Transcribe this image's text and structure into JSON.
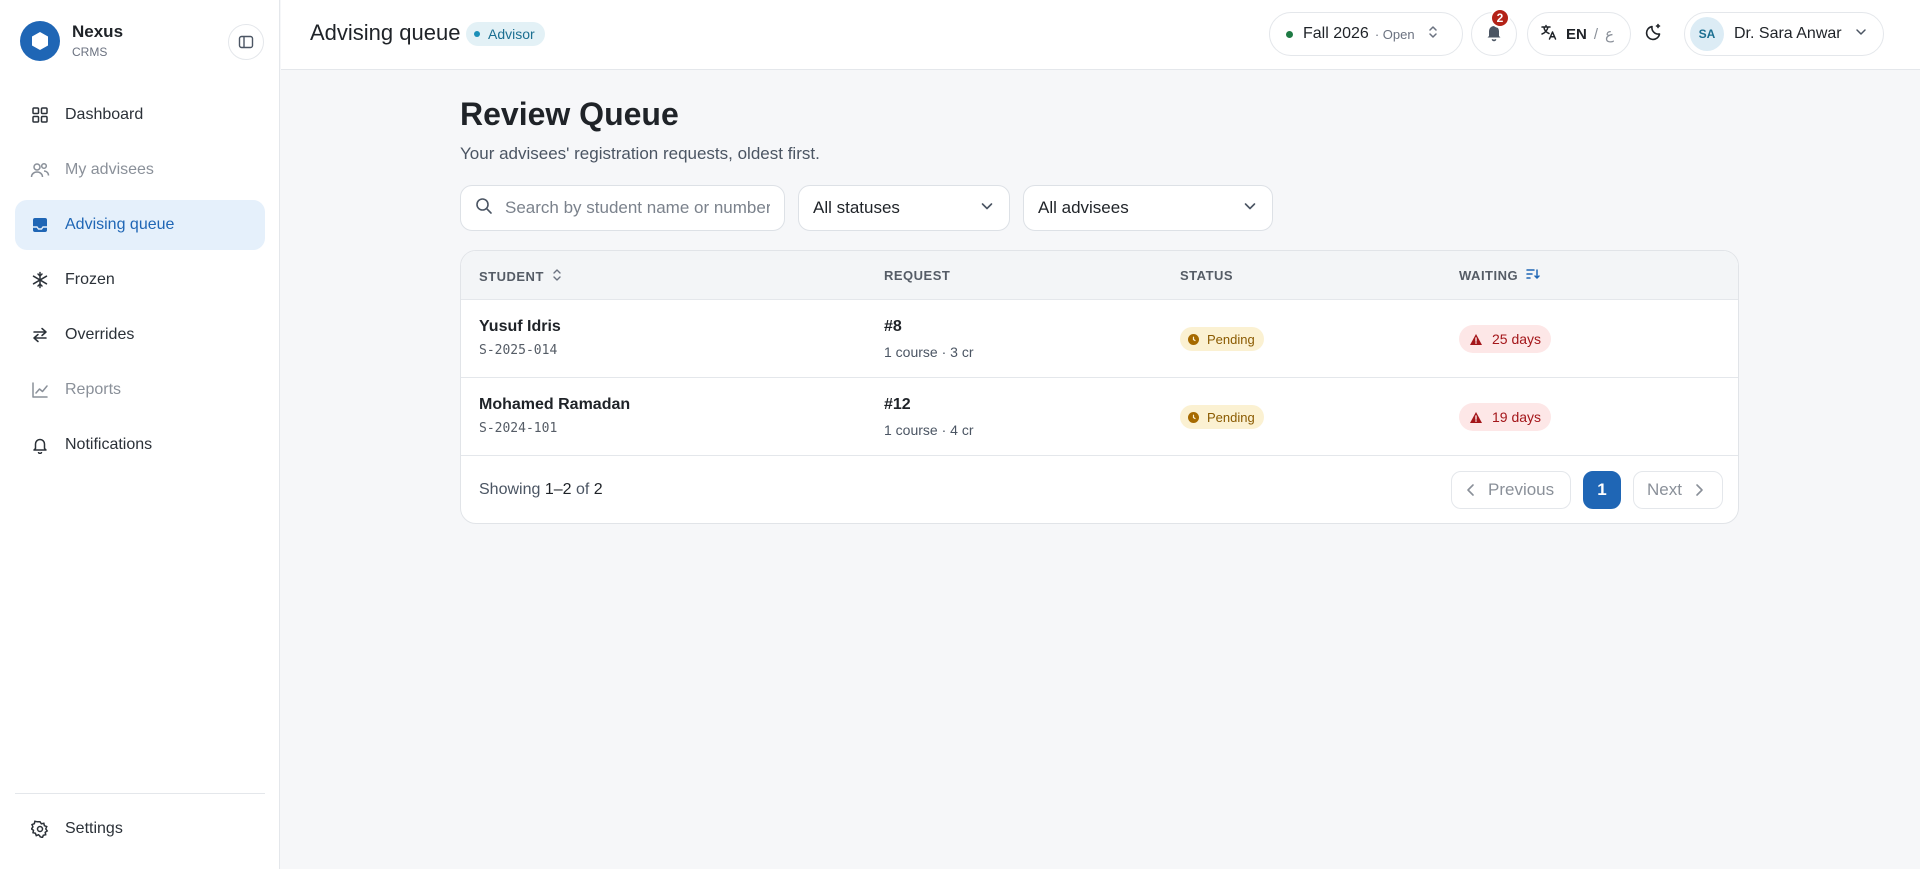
{
  "brand": {
    "name": "Nexus",
    "sub": "CRMS"
  },
  "sidebar": {
    "items": [
      {
        "label": "Dashboard",
        "icon": "grid-icon",
        "state": "normal"
      },
      {
        "label": "My advisees",
        "icon": "users-icon",
        "state": "muted"
      },
      {
        "label": "Advising queue",
        "icon": "inbox-icon",
        "state": "active"
      },
      {
        "label": "Frozen",
        "icon": "snowflake-icon",
        "state": "normal"
      },
      {
        "label": "Overrides",
        "icon": "swap-icon",
        "state": "normal"
      },
      {
        "label": "Reports",
        "icon": "chart-line-icon",
        "state": "muted"
      },
      {
        "label": "Notifications",
        "icon": "bell-icon",
        "state": "normal"
      }
    ],
    "settings_label": "Settings"
  },
  "header": {
    "title": "Advising queue",
    "role_badge": "Advisor",
    "term": "Fall 2026",
    "term_state": "· Open",
    "notifications_count": "2",
    "lang_current": "EN",
    "lang_sep": "/",
    "lang_alt": "ع",
    "user_initials": "SA",
    "user_name": "Dr. Sara Anwar"
  },
  "main": {
    "title": "Review Queue",
    "subtitle": "Your advisees' registration requests, oldest first.",
    "search_placeholder": "Search by student name or number",
    "status_filter": "All statuses",
    "advisee_filter": "All advisees"
  },
  "table": {
    "columns": {
      "student": "STUDENT",
      "request": "REQUEST",
      "status": "STATUS",
      "waiting": "WAITING"
    },
    "rows": [
      {
        "name": "Yusuf Idris",
        "id": "S-2025-014",
        "request": "#8",
        "request_detail": "1 course · 3 cr",
        "status": "Pending",
        "waiting": "25 days"
      },
      {
        "name": "Mohamed Ramadan",
        "id": "S-2024-101",
        "request": "#12",
        "request_detail": "1 course · 4 cr",
        "status": "Pending",
        "waiting": "19 days"
      }
    ],
    "footer": {
      "showing_prefix": "Showing",
      "range": "1–2",
      "of_word": "of",
      "total": "2"
    },
    "pagination": {
      "previous": "Previous",
      "current": "1",
      "next": "Next"
    }
  },
  "colors": {
    "accent": "#1f66b5",
    "pending": "#fbf1d2",
    "overdue": "#fde7e7",
    "badge": "#b42318"
  }
}
